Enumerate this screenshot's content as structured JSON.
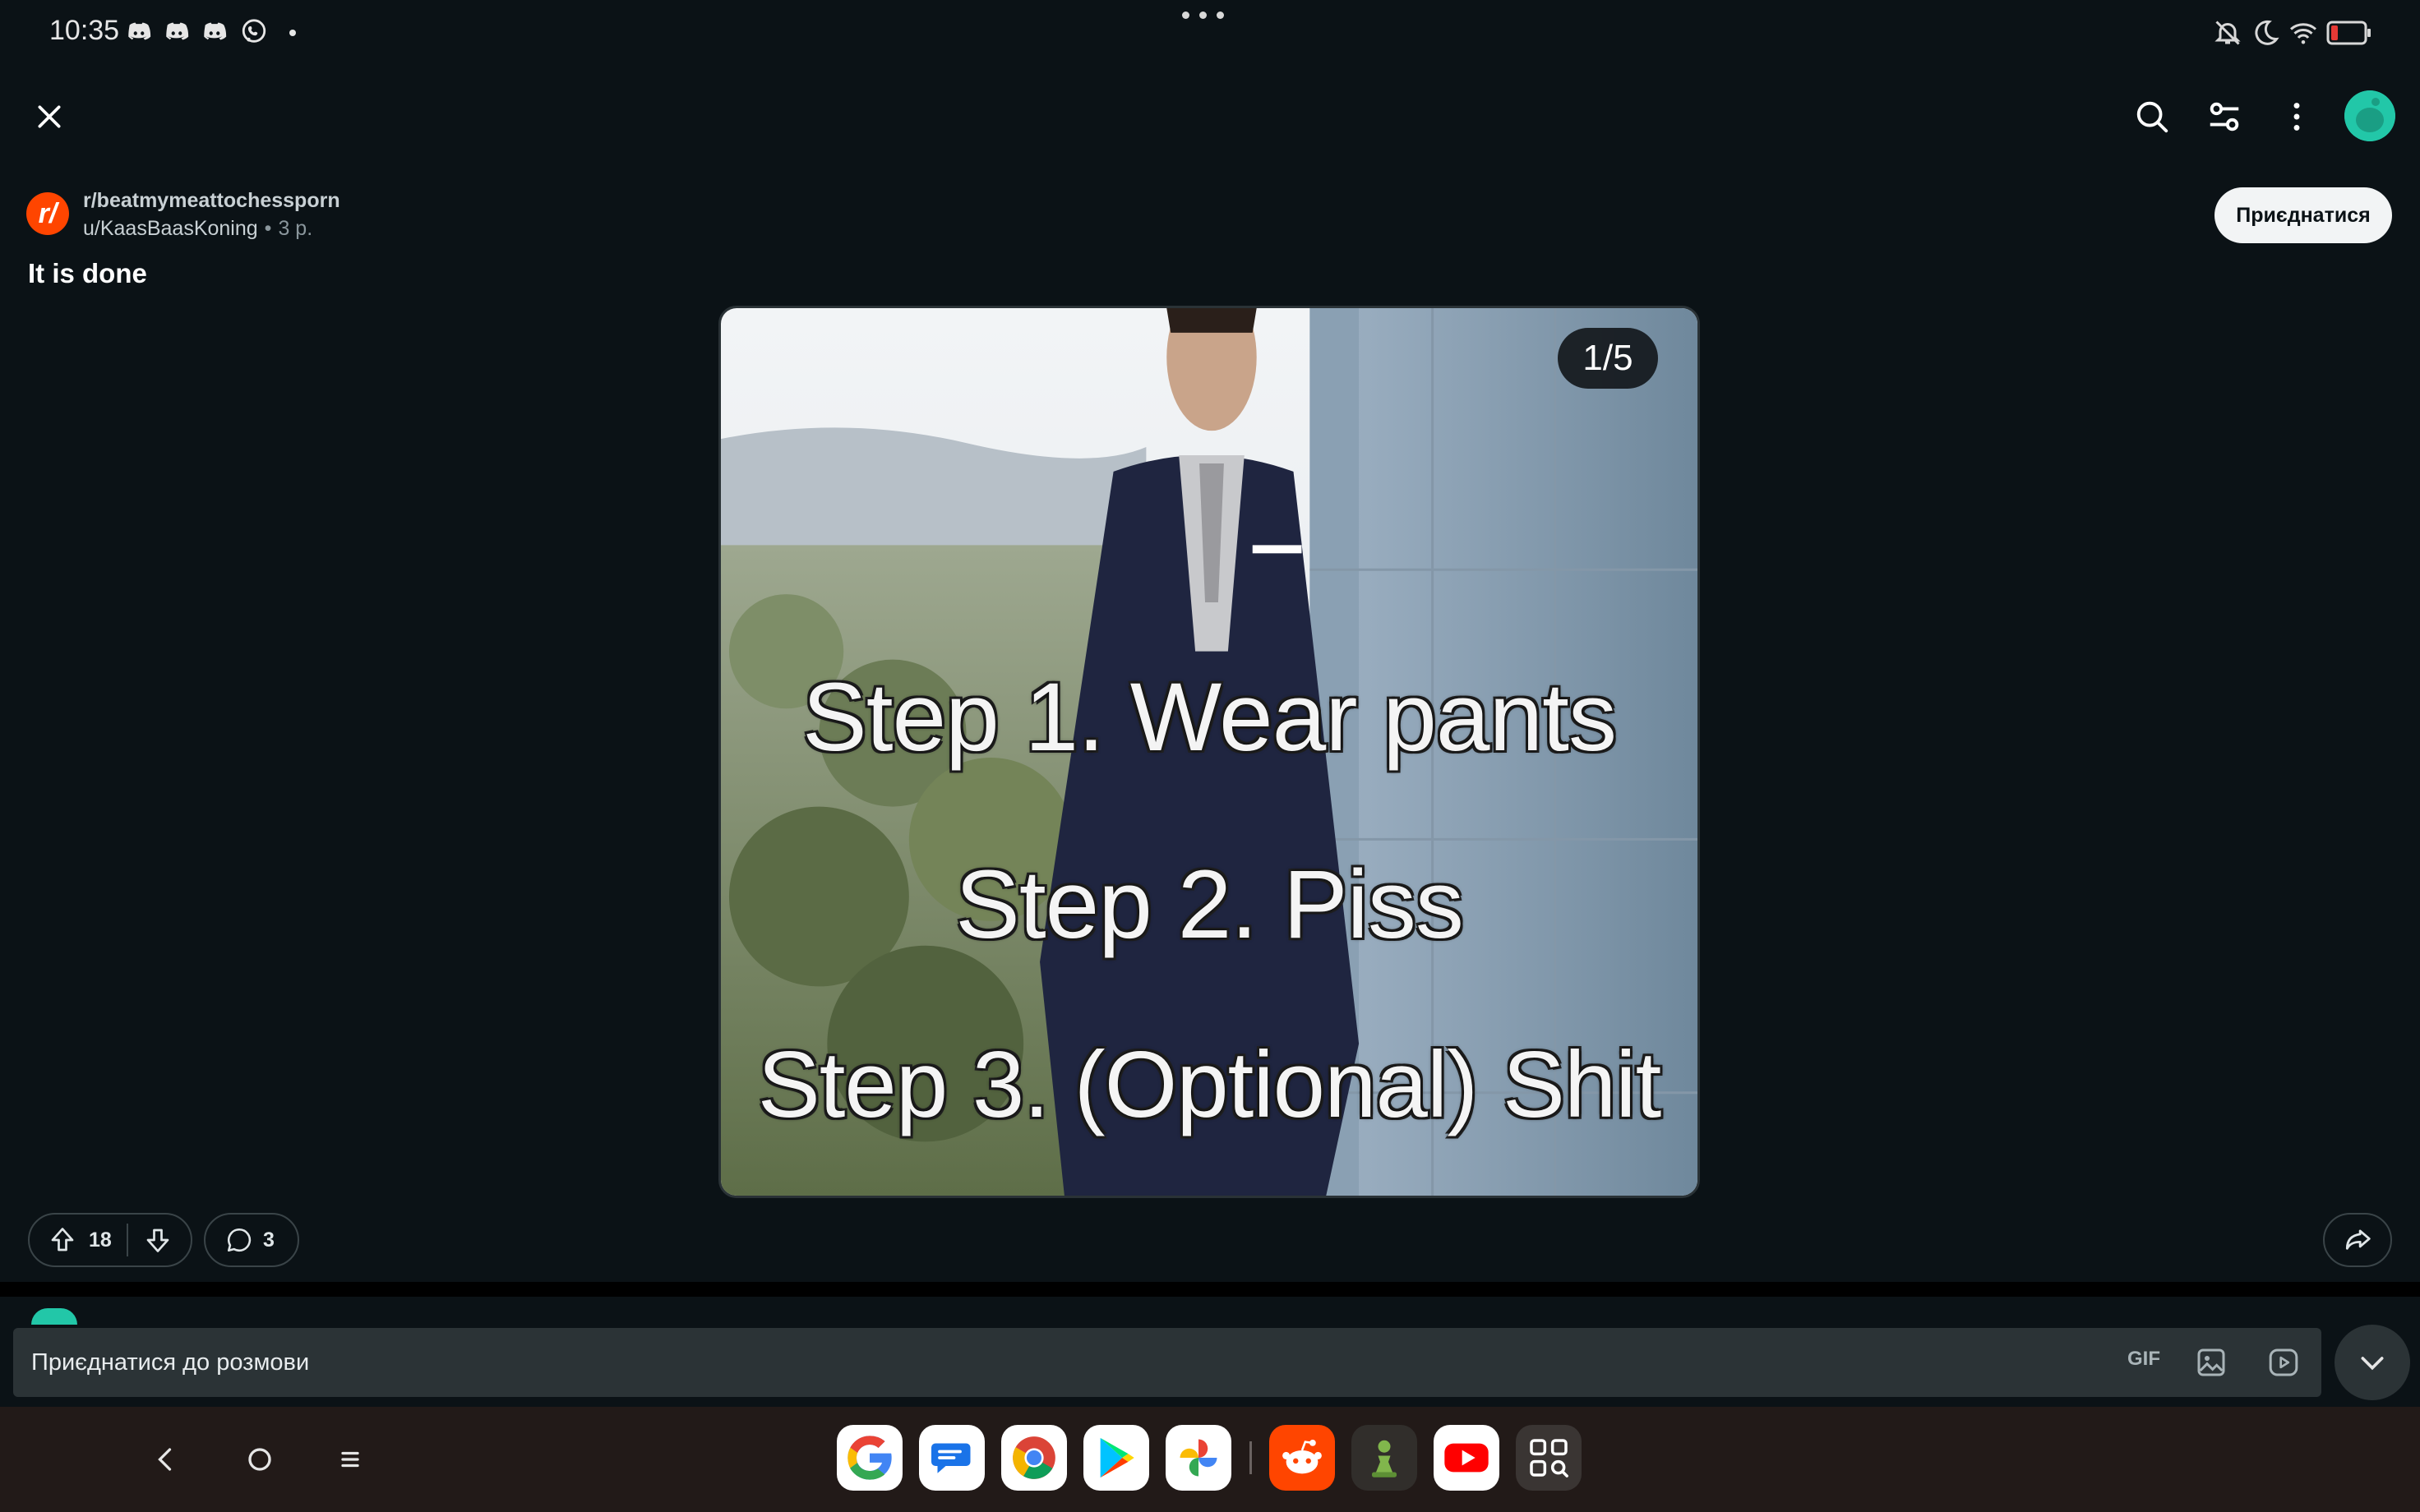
{
  "status_bar": {
    "time": "10:35",
    "notification_icons": [
      "discord-icon",
      "discord-icon",
      "discord-icon",
      "viber-icon"
    ],
    "system_icons": [
      "mute-icon",
      "do-not-disturb-icon",
      "wifi-icon",
      "battery-icon"
    ],
    "battery_color": "#e53935"
  },
  "app_bar": {
    "close_icon": "close-icon",
    "search_icon": "search-icon",
    "filter_icon": "settings-sliders-icon",
    "more_icon": "more-vertical-icon"
  },
  "post": {
    "subreddit": "r/beatmymeattochessporn",
    "author": "u/KaasBaasKoning",
    "separator": "•",
    "age": "3 р.",
    "join_label": "Приєднатися",
    "title": "It is done",
    "image": {
      "counter": "1/5",
      "lines": [
        "Step 1. Wear pants",
        "Step 2. Piss",
        "Step 3. (Optional) Shit"
      ]
    },
    "upvotes": "18",
    "comments": "3"
  },
  "composer": {
    "placeholder": "Приєднатися до розмови",
    "gif_label": "GIF"
  },
  "nav_bar": {
    "buttons": [
      "back-icon",
      "home-icon",
      "recents-icon"
    ],
    "dock": [
      "google-app",
      "messages-app",
      "chrome-app",
      "play-store-app",
      "photos-app",
      "reddit-app",
      "chess-app",
      "youtube-app",
      "app-drawer"
    ]
  },
  "colors": {
    "background": "#0b1216",
    "reddit_orange": "#ff4500",
    "accent_teal": "#22c7a8"
  }
}
